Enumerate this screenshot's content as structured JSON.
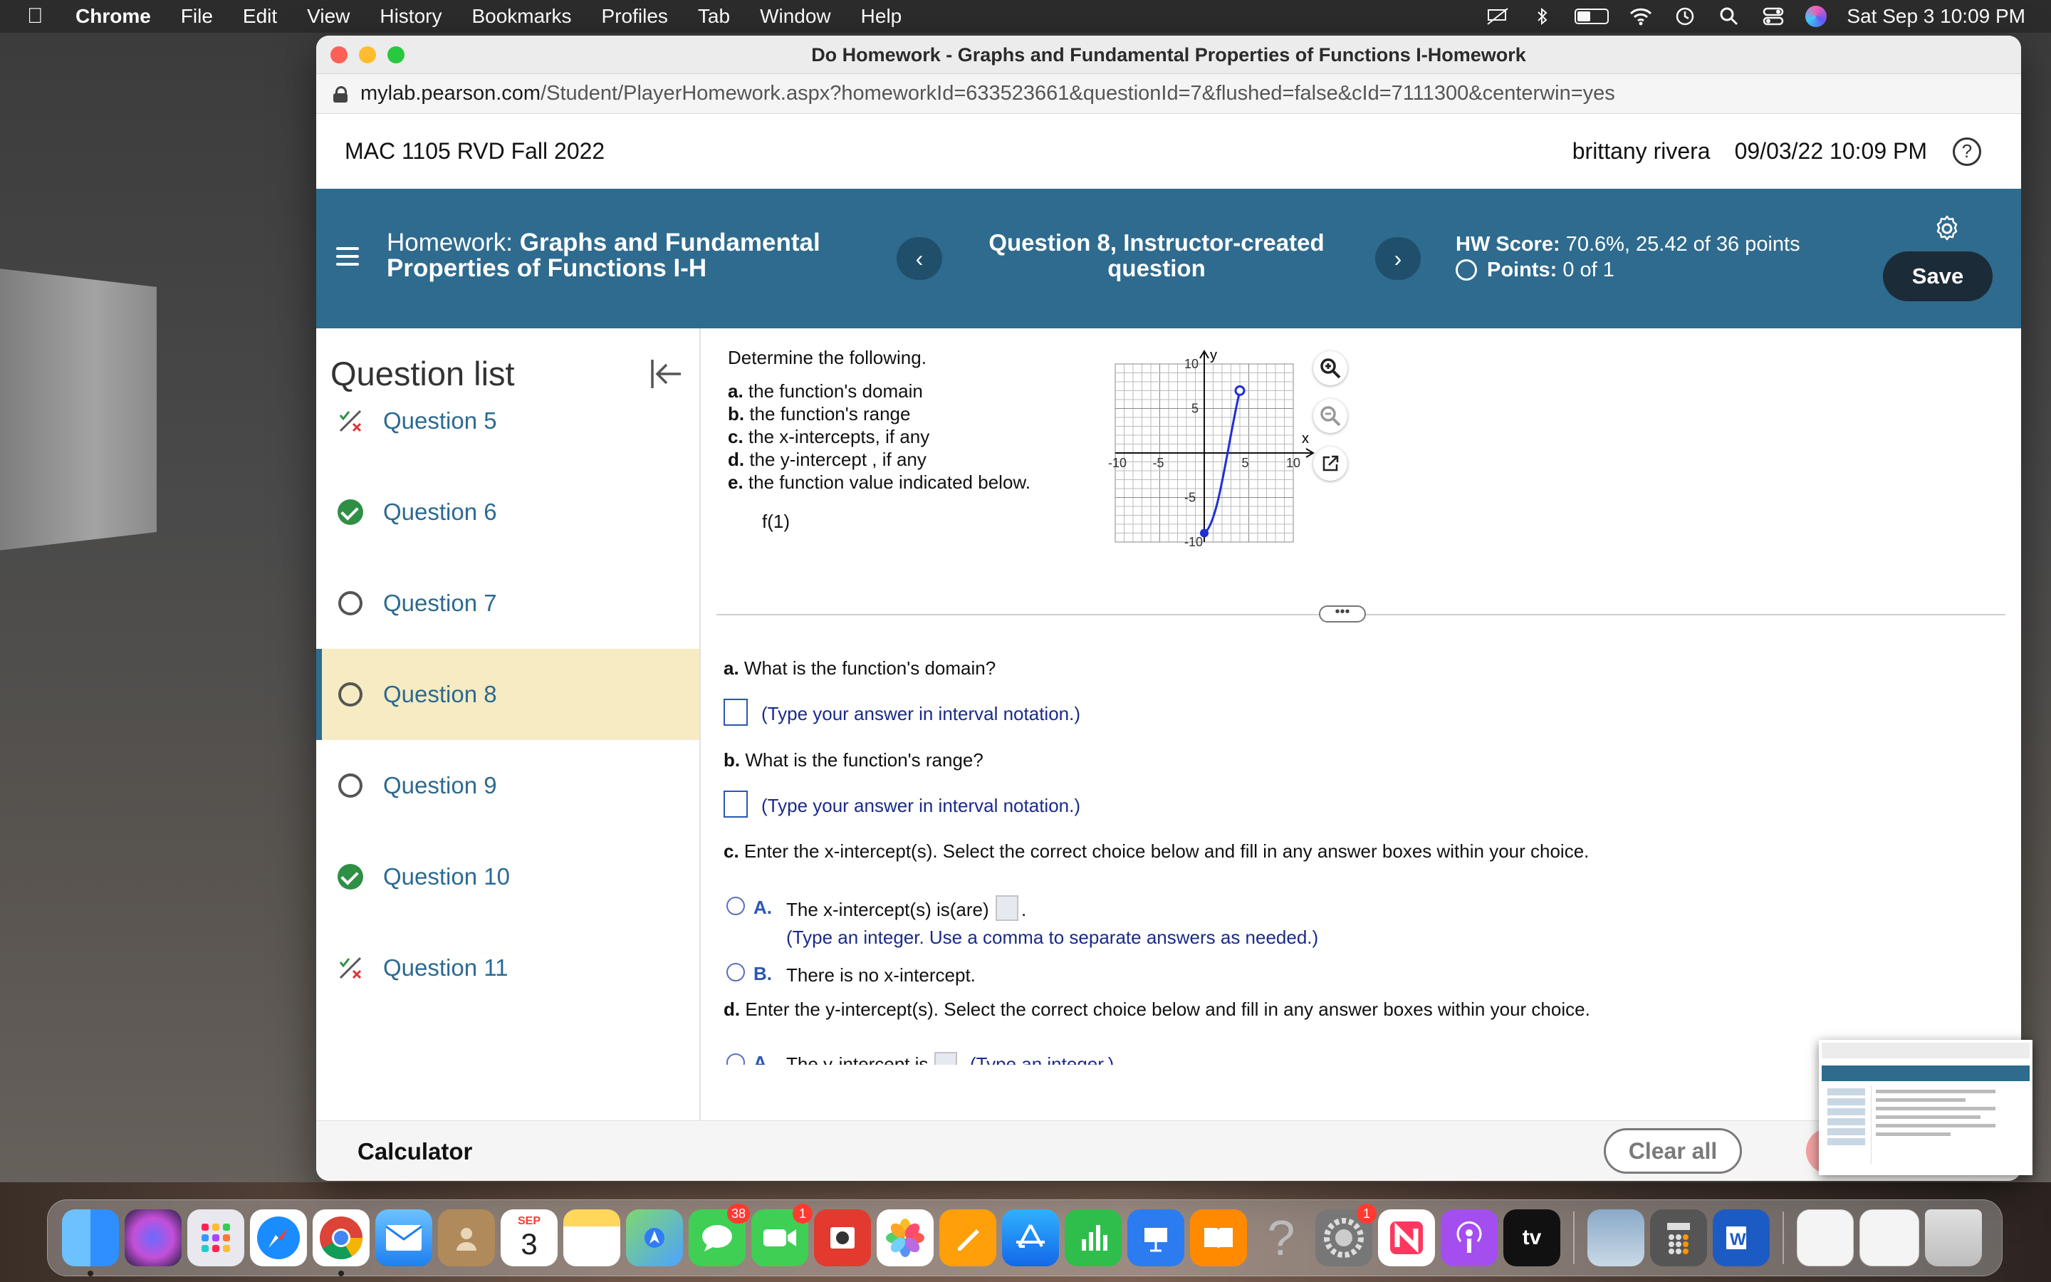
{
  "menubar": {
    "app_name": "Chrome",
    "menus": [
      "File",
      "Edit",
      "View",
      "History",
      "Bookmarks",
      "Profiles",
      "Tab",
      "Window",
      "Help"
    ],
    "datetime": "Sat Sep 3  10:09 PM"
  },
  "window": {
    "title": "Do Homework - Graphs and Fundamental Properties of Functions I-Homework",
    "url_host": "mylab.pearson.com",
    "url_path": "/Student/PlayerHomework.aspx?homeworkId=633523661&questionId=7&flushed=false&cId=7111300&centerwin=yes"
  },
  "course": {
    "title": "MAC 1105 RVD Fall 2022",
    "user": "brittany rivera",
    "date": "09/03/22 10:09 PM",
    "help_label": "?"
  },
  "hw_bar": {
    "prefix": "Homework: ",
    "title": "Graphs and Fundamental Properties of Functions I-H",
    "prev_label": "‹",
    "next_label": "›",
    "question": "Question 8, Instructor-created question",
    "score_label": "HW Score:",
    "score_value": " 70.6%, 25.42 of 36 points",
    "points_label": "Points:",
    "points_value": " 0 of 1",
    "save_label": "Save"
  },
  "question_list": {
    "heading": "Question list",
    "items": [
      {
        "label": "Question 5",
        "status": "partial"
      },
      {
        "label": "Question 6",
        "status": "correct"
      },
      {
        "label": "Question 7",
        "status": "unanswered"
      },
      {
        "label": "Question 8",
        "status": "current"
      },
      {
        "label": "Question 9",
        "status": "unanswered"
      },
      {
        "label": "Question 10",
        "status": "correct"
      },
      {
        "label": "Question 11",
        "status": "partial"
      }
    ]
  },
  "question": {
    "prompt": "Determine the following.",
    "parts": [
      {
        "letter": "a.",
        "text": " the function's domain"
      },
      {
        "letter": "b.",
        "text": " the function's range"
      },
      {
        "letter": "c.",
        "text": " the x-intercepts, if any"
      },
      {
        "letter": "d.",
        "text": " the y-intercept , if any"
      },
      {
        "letter": "e.",
        "text": " the function value indicated below."
      }
    ],
    "function_value": "f(1)",
    "graph": {
      "x_label": "x",
      "y_label": "y",
      "x_range": [
        -10,
        10
      ],
      "y_range": [
        -10,
        10
      ],
      "x_ticks": [
        "-10",
        "-5",
        "5",
        "10"
      ],
      "y_ticks": [
        "10",
        "5",
        "-5",
        "-10"
      ],
      "closed_point": [
        0,
        -9
      ],
      "open_point": [
        4,
        7
      ],
      "curve_color": "#1f2fd6"
    }
  },
  "answers": {
    "a_letter": "a.",
    "a_question": "What is the function's domain?",
    "a_hint": "(Type your answer in interval notation.)",
    "b_letter": "b.",
    "b_question": "What is the function's range?",
    "b_hint": "(Type your answer in interval notation.)",
    "c_letter": "c.",
    "c_question": "Enter the x-intercept(s). Select the correct choice below and fill in any answer boxes within your choice.",
    "c_option_a_letter": "A.",
    "c_option_a_text": "The x-intercept(s) is(are)",
    "c_option_a_hint": "(Type an integer. Use a comma to separate answers as needed.)",
    "c_option_b_letter": "B.",
    "c_option_b_text": "There is no x-intercept.",
    "d_letter": "d.",
    "d_question": "Enter the y-intercept(s). Select the correct choice below and fill in any answer boxes within your choice.",
    "d_option_a_letter": "A.",
    "d_option_a_text": "The y-intercept is",
    "d_option_a_hint": "(Type an integer.)"
  },
  "footer": {
    "calculator_label": "Calculator",
    "clear_all_label": "Clear all"
  },
  "dock": {
    "calendar_month": "SEP",
    "calendar_day": "3",
    "messages_badge": "38",
    "facetime_badge": "1",
    "settings_badge": "1",
    "tv_label": "tv"
  }
}
